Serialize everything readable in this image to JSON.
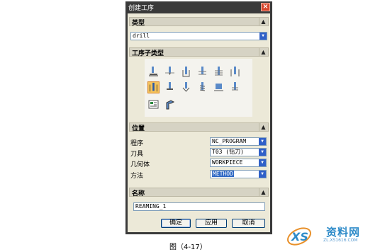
{
  "dialog": {
    "title": "创建工序",
    "close_icon": "close-icon"
  },
  "type_section": {
    "header": "类型",
    "selected": "drill"
  },
  "subtype_section": {
    "header": "工序子类型",
    "icons": [
      "spot-facing-icon",
      "spot-drilling-icon",
      "drilling-icon",
      "peck-drilling-icon",
      "breakchip-drilling-icon",
      "boring-icon",
      "reaming-icon",
      "counterboring-icon",
      "countersinking-icon",
      "tapping-icon",
      "hole-milling-icon",
      "thread-milling-icon",
      "mill-control-icon",
      "mill-user-icon"
    ],
    "selected_icon": "reaming-icon"
  },
  "location_section": {
    "header": "位置",
    "rows": [
      {
        "label": "程序",
        "value": "NC_PROGRAM"
      },
      {
        "label": "刀具",
        "value": "T03 (钻刀)"
      },
      {
        "label": "几何体",
        "value": "WORKPIECE"
      },
      {
        "label": "方法",
        "value": "METHOD"
      }
    ]
  },
  "name_section": {
    "header": "名称",
    "value": "REAMING_1"
  },
  "buttons": {
    "ok": "确定",
    "apply": "应用",
    "cancel": "取消"
  },
  "caption": "图（4-17）",
  "watermark": {
    "text": "资料网",
    "url": "ZL.XS1616.COM"
  },
  "colors": {
    "titlebar": "#3a3a3a",
    "dialog_bg": "#ece9d8",
    "selection": "#f6c35b",
    "combo_arrow": "#3060c8",
    "highlight": "#316ac5"
  }
}
